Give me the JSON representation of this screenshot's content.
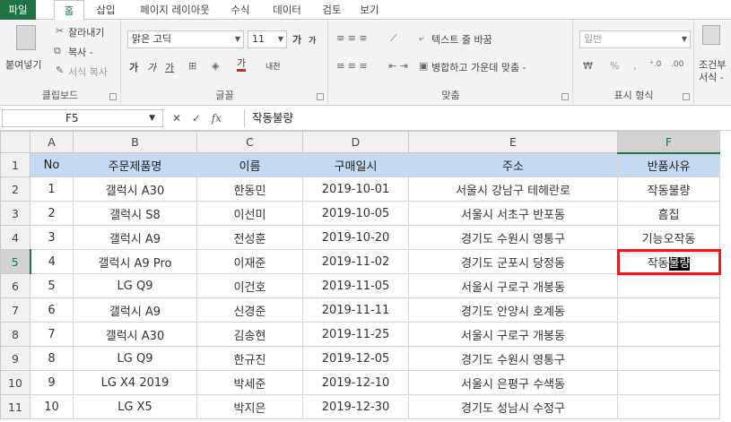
{
  "tabs": [
    "파일",
    "홈",
    "삽입",
    "페이지 레이아웃",
    "수식",
    "데이터",
    "검토",
    "보기"
  ],
  "ribbon": {
    "clipboard": {
      "paste": "붙여넣기",
      "cut": "잘라내기",
      "copy": "복사 -",
      "format_painter": "서식 복사",
      "label": "클립보드"
    },
    "font": {
      "name": "맑은 고딕",
      "size": "11",
      "label": "글꼴",
      "grow": "가",
      "shrink": "가",
      "bold": "가",
      "italic": "가",
      "underline": "가",
      "color_glyph": "가",
      "phonetic": "내천"
    },
    "alignment": {
      "wrap_text": "텍스트 줄 바꿈",
      "merge_center": "병합하고 가운데 맞춤 -",
      "label": "맞춤"
    },
    "number": {
      "format": "일반",
      "percent": "%",
      "comma": ",",
      "label": "표시 형식"
    },
    "styles": {
      "conditional1": "조건부",
      "conditional2": "서식 -"
    }
  },
  "formula_bar": {
    "cell_ref": "F5",
    "fx": "fx",
    "content": "작동불량"
  },
  "columns": [
    "A",
    "B",
    "C",
    "D",
    "E",
    "F"
  ],
  "headers": [
    "No",
    "주문제품명",
    "이름",
    "구매일시",
    "주소",
    "반품사유"
  ],
  "rows": [
    [
      "1",
      "갤럭시 A30",
      "한동민",
      "2019-10-01",
      "서울시 강남구 테헤란로",
      "작동불량"
    ],
    [
      "2",
      "갤럭시 S8",
      "이선미",
      "2019-10-05",
      "서울시 서초구 반포동",
      "흠집"
    ],
    [
      "3",
      "갤럭시 A9",
      "전성훈",
      "2019-10-20",
      "경기도 수원시 영통구",
      "기능오작동"
    ],
    [
      "4",
      "갤럭시 A9 Pro",
      "이재준",
      "2019-11-02",
      "경기도 군포시 당정동",
      "작동불량"
    ],
    [
      "5",
      "LG Q9",
      "이건호",
      "2019-11-05",
      "서울시 구로구 개봉동",
      ""
    ],
    [
      "6",
      "갤럭시 A9",
      "신경준",
      "2019-11-11",
      "경기도 안양시 호계동",
      ""
    ],
    [
      "7",
      "갤럭시 A30",
      "김송현",
      "2019-11-25",
      "서울시 구로구 개봉동",
      ""
    ],
    [
      "8",
      "LG Q9",
      "한규진",
      "2019-12-05",
      "경기도 수원시 영통구",
      ""
    ],
    [
      "9",
      "LG X4 2019",
      "박세준",
      "2019-12-10",
      "서울시 은평구 수색동",
      ""
    ],
    [
      "10",
      "LG X5",
      "박지은",
      "2019-12-30",
      "경기도 성남시 수정구",
      ""
    ]
  ],
  "active_cell": {
    "prefix": "작동",
    "selected": "불량"
  },
  "colors": {
    "accent": "#217346",
    "header_fill": "#c5d9f1",
    "selection_border": "#e31b23"
  }
}
